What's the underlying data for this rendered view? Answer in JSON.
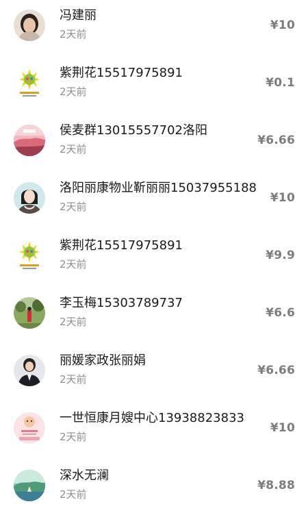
{
  "donations": [
    {
      "name": "冯建丽",
      "time": "2天前",
      "amount": "¥10",
      "avatar_icon": "woman-portrait-avatar-icon",
      "avatar_color": "#d9c7b5"
    },
    {
      "name": "紫荆花15517975891",
      "time": "2天前",
      "amount": "¥0.1",
      "avatar_icon": "sun-flower-logo-avatar-icon",
      "avatar_color": "#f3d21b"
    },
    {
      "name": "侯麦群13015557702洛阳",
      "time": "2天前",
      "amount": "¥6.66",
      "avatar_icon": "pink-landscape-avatar-icon",
      "avatar_color": "#e78f9d"
    },
    {
      "name": "洛阳丽康物业靳丽丽15037955188",
      "time": "2天前",
      "amount": "¥10",
      "avatar_icon": "illustrated-woman-avatar-icon",
      "avatar_color": "#bfe0e6"
    },
    {
      "name": "紫荆花15517975891",
      "time": "2天前",
      "amount": "¥9.9",
      "avatar_icon": "sun-flower-logo-avatar-icon",
      "avatar_color": "#f3d21b"
    },
    {
      "name": "李玉梅15303789737",
      "time": "2天前",
      "amount": "¥6.6",
      "avatar_icon": "garden-person-avatar-icon",
      "avatar_color": "#6f8a4b"
    },
    {
      "name": "丽媛家政张丽娟",
      "time": "2天前",
      "amount": "¥6.66",
      "avatar_icon": "businesswoman-avatar-icon",
      "avatar_color": "#d7dce3"
    },
    {
      "name": "一世恒康月嫂中心13938823833",
      "time": "2天前",
      "amount": "¥10",
      "avatar_icon": "baby-logo-avatar-icon",
      "avatar_color": "#f6c9cf"
    },
    {
      "name": "深水无澜",
      "time": "2天前",
      "amount": "¥8.88",
      "avatar_icon": "lake-landscape-avatar-icon",
      "avatar_color": "#5fa88b"
    }
  ]
}
